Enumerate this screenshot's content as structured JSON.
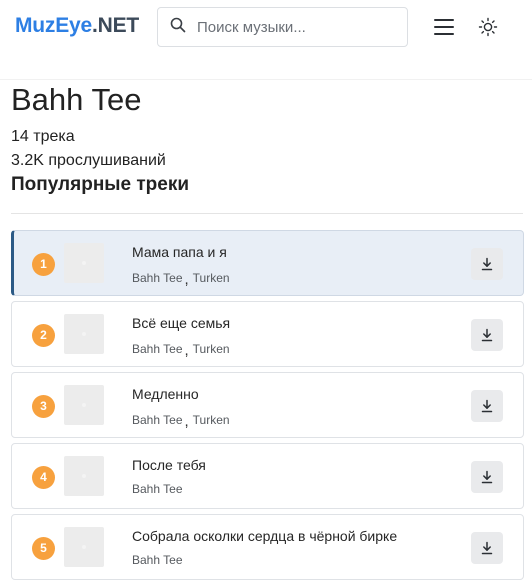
{
  "header": {
    "logo_part1": "MuzEye",
    "logo_part2": ".NET",
    "search_placeholder": "Поиск музыки...",
    "icons": [
      "search-icon",
      "menu-icon",
      "sun-icon"
    ]
  },
  "artist": {
    "name": "Bahh Tee",
    "tracks_count": "14 трека",
    "plays_count": "3.2K прослушиваний"
  },
  "section_title": "Популярные треки",
  "colors": {
    "brand_blue": "#2d7fe4",
    "rank_badge": "#f7a13e",
    "active_row_bg": "#e8eef6",
    "active_row_accent": "#2c5a86"
  },
  "tracks": [
    {
      "rank": "1",
      "title": "Мама папа и я",
      "artist1": "Bahh Tee",
      "separator": ",",
      "artist2": "Turken",
      "active": true
    },
    {
      "rank": "2",
      "title": "Всё еще семья",
      "artist1": "Bahh Tee",
      "separator": ",",
      "artist2": "Turken",
      "active": false
    },
    {
      "rank": "3",
      "title": "Медленно",
      "artist1": "Bahh Tee",
      "separator": ",",
      "artist2": "Turken",
      "active": false
    },
    {
      "rank": "4",
      "title": "После тебя",
      "artist1": "Bahh Tee",
      "separator": "",
      "artist2": "",
      "active": false
    },
    {
      "rank": "5",
      "title": "Собрала осколки сердца в чёрной бирке",
      "artist1": "Bahh Tee",
      "separator": "",
      "artist2": "",
      "active": false
    }
  ]
}
